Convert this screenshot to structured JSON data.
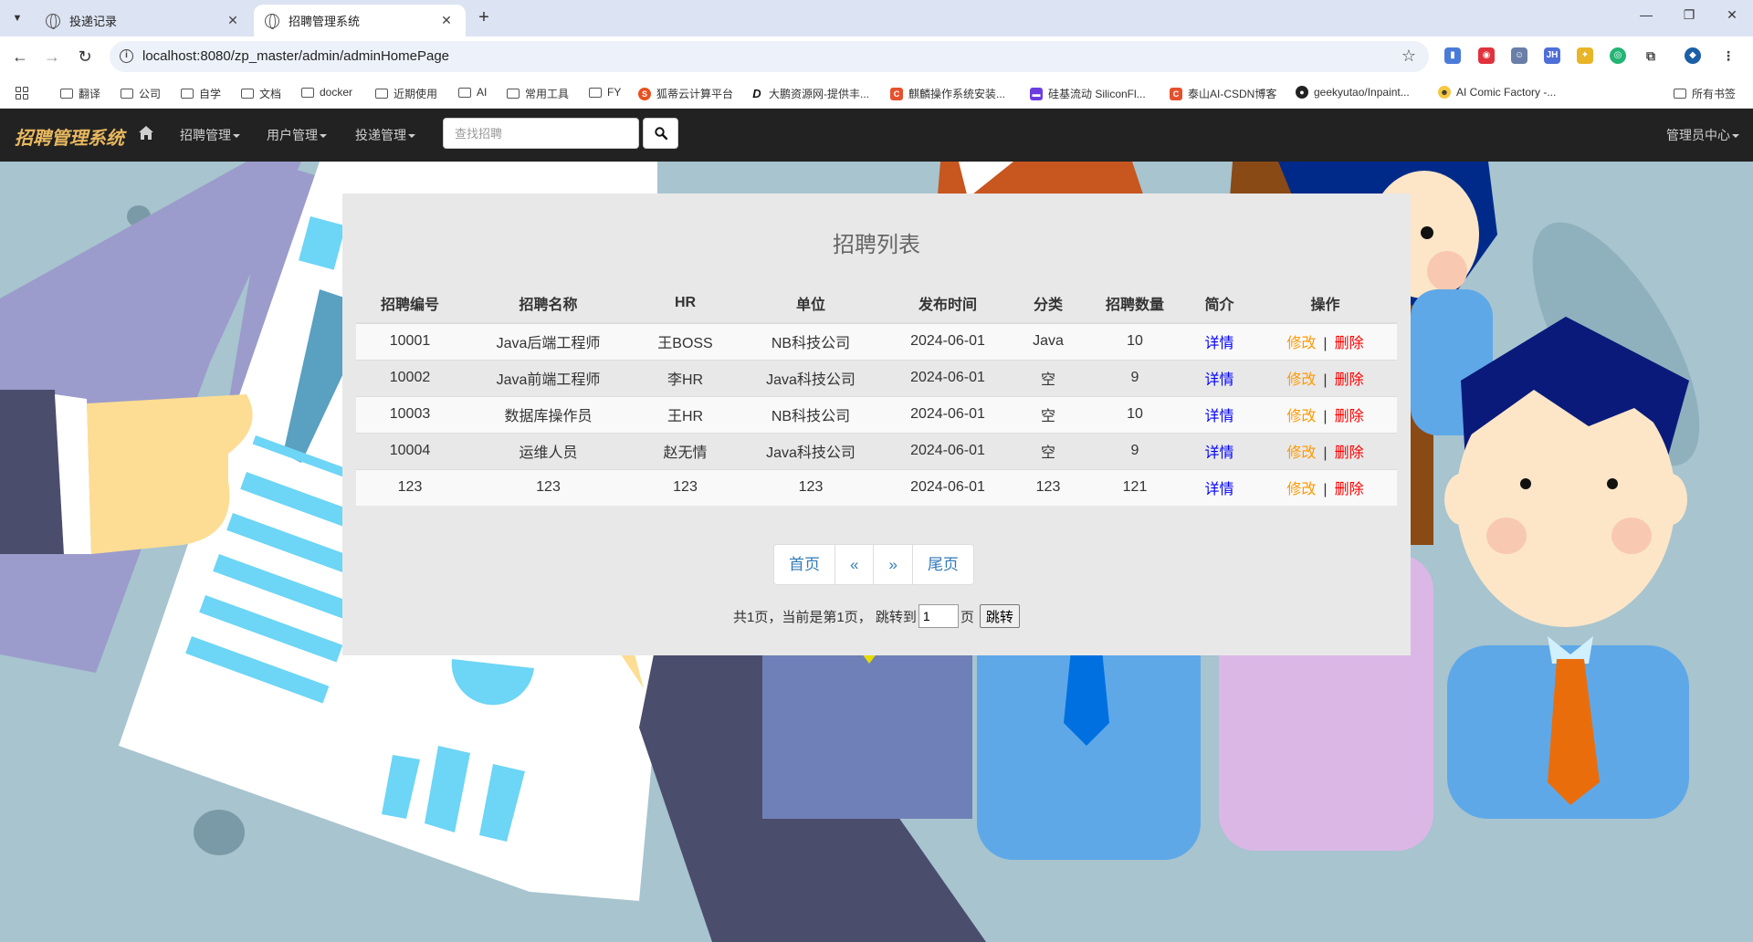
{
  "browser": {
    "tabs": [
      {
        "title": "投递记录"
      },
      {
        "title": "招聘管理系统"
      }
    ],
    "url": "localhost:8080/zp_master/admin/adminHomePage",
    "bookmarks": [
      "翻译",
      "公司",
      "自学",
      "文档",
      "docker",
      "近期使用",
      "AI",
      "常用工具",
      "FY",
      "狐蒂云计算平台",
      "大鹏资源网-提供丰...",
      "麒麟操作系统安装...",
      "硅基流动 SiliconFl...",
      "泰山AI-CSDN博客",
      "geekyutao/Inpaint...",
      "AI Comic Factory -..."
    ],
    "all_bookmarks": "所有书签"
  },
  "navbar": {
    "brand": "招聘管理系统",
    "menus": [
      "招聘管理",
      "用户管理",
      "投递管理"
    ],
    "search_placeholder": "查找招聘",
    "admin_menu": "管理员中心"
  },
  "panel": {
    "title": "招聘列表",
    "columns": [
      "招聘编号",
      "招聘名称",
      "HR",
      "单位",
      "发布时间",
      "分类",
      "招聘数量",
      "简介",
      "操作"
    ],
    "rows": [
      {
        "id": "10001",
        "name": "Java后端工程师",
        "hr": "王BOSS",
        "company": "NB科技公司",
        "date": "2024-06-01",
        "category": "Java",
        "count": "10"
      },
      {
        "id": "10002",
        "name": "Java前端工程师",
        "hr": "李HR",
        "company": "Java科技公司",
        "date": "2024-06-01",
        "category": "空",
        "count": "9"
      },
      {
        "id": "10003",
        "name": "数据库操作员",
        "hr": "王HR",
        "company": "NB科技公司",
        "date": "2024-06-01",
        "category": "空",
        "count": "10"
      },
      {
        "id": "10004",
        "name": "运维人员",
        "hr": "赵无情",
        "company": "Java科技公司",
        "date": "2024-06-01",
        "category": "空",
        "count": "9"
      },
      {
        "id": "123",
        "name": "123",
        "hr": "123",
        "company": "123",
        "date": "2024-06-01",
        "category": "123",
        "count": "121"
      }
    ],
    "detail_label": "详情",
    "edit_label": "修改",
    "separator": "|",
    "delete_label": "删除",
    "pager": {
      "first": "首页",
      "prev": "«",
      "next": "»",
      "last": "尾页"
    },
    "page_info": "共1页，当前是第1页， 跳转到",
    "page_input_value": "1",
    "page_unit": "页",
    "jump_label": "跳转"
  }
}
